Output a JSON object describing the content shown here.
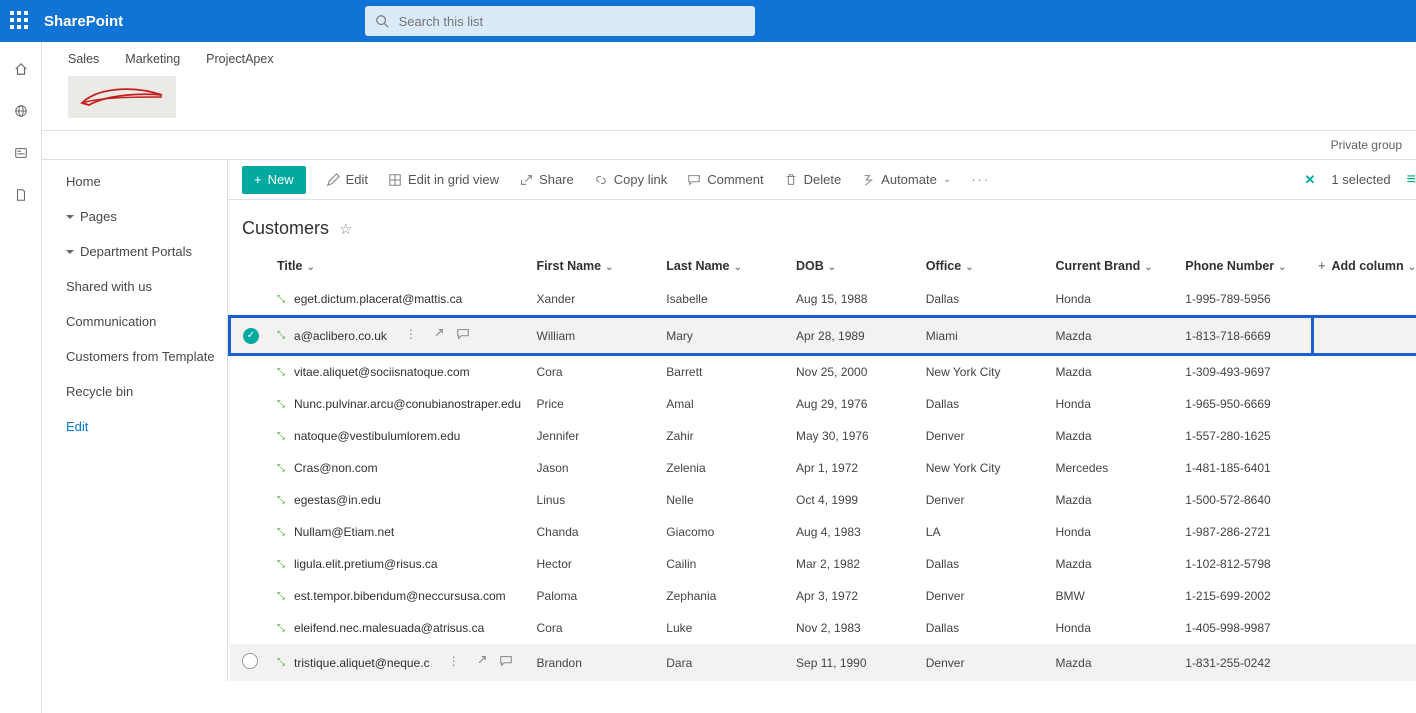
{
  "suite": {
    "product": "SharePoint",
    "search_placeholder": "Search this list"
  },
  "hub_nav": [
    "Sales",
    "Marketing",
    "ProjectApex"
  ],
  "group_label": "Private group",
  "left_nav": {
    "home": "Home",
    "pages": "Pages",
    "portals": "Department Portals",
    "shared": "Shared with us",
    "comm": "Communication",
    "cft": "Customers from Template",
    "recycle": "Recycle bin",
    "edit": "Edit"
  },
  "cmdbar": {
    "new": "New",
    "edit": "Edit",
    "gridview": "Edit in grid view",
    "share": "Share",
    "copylink": "Copy link",
    "comment": "Comment",
    "delete": "Delete",
    "automate": "Automate",
    "selected": "1 selected"
  },
  "list": {
    "name": "Customers"
  },
  "columns": {
    "title": "Title",
    "first": "First Name",
    "last": "Last Name",
    "dob": "DOB",
    "office": "Office",
    "brand": "Current Brand",
    "phone": "Phone Number",
    "add": "Add column"
  },
  "rows": [
    {
      "title": "eget.dictum.placerat@mattis.ca",
      "first": "Xander",
      "last": "Isabelle",
      "dob": "Aug 15, 1988",
      "office": "Dallas",
      "brand": "Honda",
      "phone": "1-995-789-5956"
    },
    {
      "title": "a@aclibero.co.uk",
      "first": "William",
      "last": "Mary",
      "dob": "Apr 28, 1989",
      "office": "Miami",
      "brand": "Mazda",
      "phone": "1-813-718-6669",
      "selected": true,
      "show_actions": true
    },
    {
      "title": "vitae.aliquet@sociisnatoque.com",
      "first": "Cora",
      "last": "Barrett",
      "dob": "Nov 25, 2000",
      "office": "New York City",
      "brand": "Mazda",
      "phone": "1-309-493-9697"
    },
    {
      "title": "Nunc.pulvinar.arcu@conubianostraper.edu",
      "first": "Price",
      "last": "Amal",
      "dob": "Aug 29, 1976",
      "office": "Dallas",
      "brand": "Honda",
      "phone": "1-965-950-6669"
    },
    {
      "title": "natoque@vestibulumlorem.edu",
      "first": "Jennifer",
      "last": "Zahir",
      "dob": "May 30, 1976",
      "office": "Denver",
      "brand": "Mazda",
      "phone": "1-557-280-1625"
    },
    {
      "title": "Cras@non.com",
      "first": "Jason",
      "last": "Zelenia",
      "dob": "Apr 1, 1972",
      "office": "New York City",
      "brand": "Mercedes",
      "phone": "1-481-185-6401"
    },
    {
      "title": "egestas@in.edu",
      "first": "Linus",
      "last": "Nelle",
      "dob": "Oct 4, 1999",
      "office": "Denver",
      "brand": "Mazda",
      "phone": "1-500-572-8640"
    },
    {
      "title": "Nullam@Etiam.net",
      "first": "Chanda",
      "last": "Giacomo",
      "dob": "Aug 4, 1983",
      "office": "LA",
      "brand": "Honda",
      "phone": "1-987-286-2721"
    },
    {
      "title": "ligula.elit.pretium@risus.ca",
      "first": "Hector",
      "last": "Cailin",
      "dob": "Mar 2, 1982",
      "office": "Dallas",
      "brand": "Mazda",
      "phone": "1-102-812-5798"
    },
    {
      "title": "est.tempor.bibendum@neccursusa.com",
      "first": "Paloma",
      "last": "Zephania",
      "dob": "Apr 3, 1972",
      "office": "Denver",
      "brand": "BMW",
      "phone": "1-215-699-2002"
    },
    {
      "title": "eleifend.nec.malesuada@atrisus.ca",
      "first": "Cora",
      "last": "Luke",
      "dob": "Nov 2, 1983",
      "office": "Dallas",
      "brand": "Honda",
      "phone": "1-405-998-9987"
    },
    {
      "title": "tristique.aliquet@neque.c",
      "first": "Brandon",
      "last": "Dara",
      "dob": "Sep 11, 1990",
      "office": "Denver",
      "brand": "Mazda",
      "phone": "1-831-255-0242",
      "hovered": true,
      "show_actions": true
    }
  ]
}
